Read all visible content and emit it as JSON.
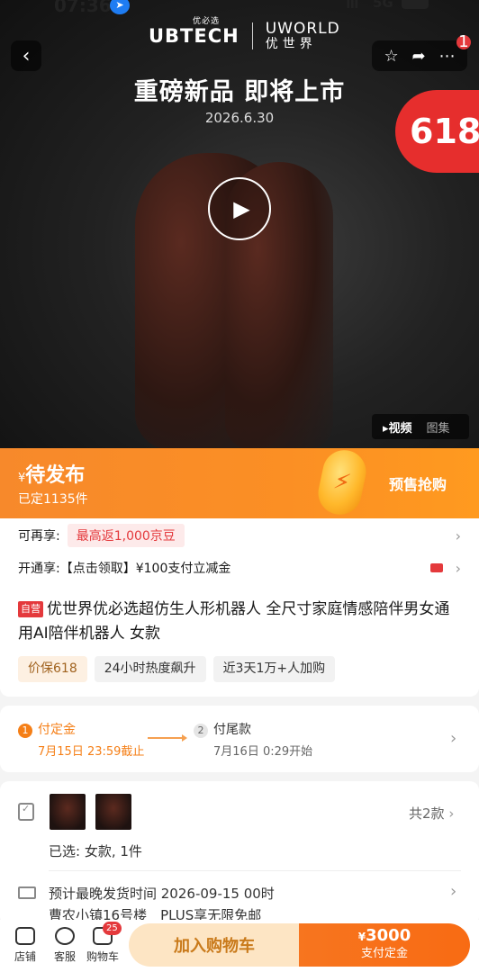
{
  "status_bar": {
    "time": "07:36",
    "network": "5G"
  },
  "hero": {
    "brand_left": "UBTECH",
    "brand_left_cn": "优必选",
    "brand_right_en": "UWORLD",
    "brand_right_cn": "优世界",
    "title": "重磅新品 即将上市",
    "date": "2026.6.30",
    "promo_tag": "618",
    "more_badge": "1",
    "media_tabs": [
      "▸视频",
      "图集"
    ]
  },
  "presale": {
    "currency": "¥",
    "status": "待发布",
    "reserved_count": "已定1135件",
    "action": "预售抢购"
  },
  "benefits": {
    "row1_label": "可再享:",
    "row1_tag": "最高返1,000京豆",
    "row2_text": "开通享:【点击领取】¥100支付立减金"
  },
  "product": {
    "self_tag": "自营",
    "title": "优世界优必选超仿生人形机器人 全尺寸家庭情感陪伴男女通用AI陪伴机器人 女款",
    "chips": [
      "价保618",
      "24小时热度飙升",
      "近3天1万+人加购"
    ]
  },
  "payment_steps": {
    "step1_num": "1",
    "step1_title": "付定金",
    "step1_sub": "7月15日 23:59截止",
    "step2_num": "2",
    "step2_title": "付尾款",
    "step2_sub": "7月16日 0:29开始"
  },
  "selection": {
    "total": "共2款",
    "selected": "已选: 女款, 1件",
    "ship_time": "预计最晚发货时间 2026-09-15 00时",
    "address": "曹农小镇16号楼　PLUS享无限免邮"
  },
  "bottom_bar": {
    "store": "店铺",
    "service": "客服",
    "cart": "购物车",
    "cart_badge": "25",
    "add_to_cart": "加入购物车",
    "pay_price_symbol": "¥",
    "pay_price": "3000",
    "pay_label": "支付定金"
  },
  "colors": {
    "accent_orange": "#f7751f",
    "jd_red": "#e4393c"
  }
}
